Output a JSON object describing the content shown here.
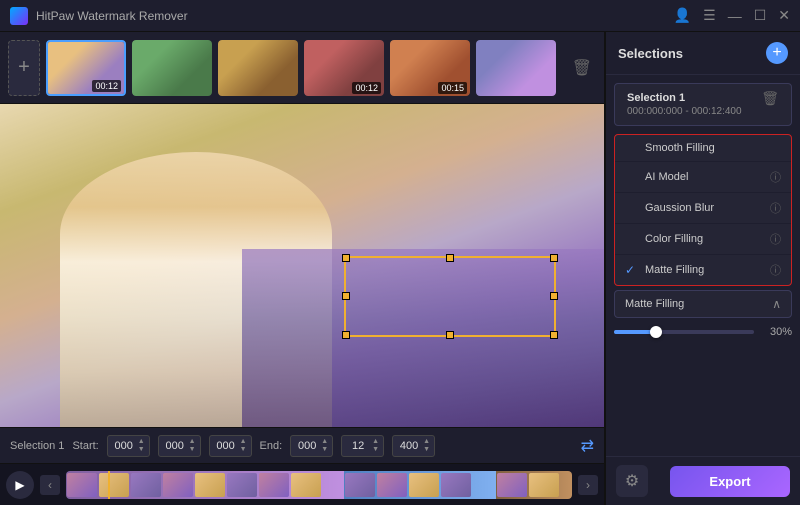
{
  "titlebar": {
    "title": "HitPaw Watermark Remover",
    "controls": [
      "user-icon",
      "menu-icon",
      "minimize-icon",
      "maximize-icon",
      "close-icon"
    ]
  },
  "toolbar": {
    "add_label": "+",
    "delete_label": "🗑"
  },
  "thumbnails": [
    {
      "id": 1,
      "duration": "00:12",
      "active": true
    },
    {
      "id": 2,
      "duration": "",
      "active": false
    },
    {
      "id": 3,
      "duration": "",
      "active": false
    },
    {
      "id": 4,
      "duration": "00:12",
      "active": false
    },
    {
      "id": 5,
      "duration": "00:15",
      "active": false
    },
    {
      "id": 6,
      "duration": "",
      "active": false
    }
  ],
  "control_bar": {
    "selection_label": "Selection 1",
    "start_label": "Start:",
    "end_label": "End:",
    "start_h": "000",
    "start_m": "000",
    "start_s": "000",
    "end_h": "000",
    "end_m": "12",
    "end_s": "400"
  },
  "right_panel": {
    "title": "Selections",
    "add_icon": "+",
    "selection1": {
      "name": "Selection 1",
      "time": "000:000:000 - 000:12:400"
    }
  },
  "methods": [
    {
      "label": "Smooth Filling",
      "info": "",
      "checked": false
    },
    {
      "label": "AI Model",
      "info": "ⓘ",
      "checked": false
    },
    {
      "label": "Gaussion Blur",
      "info": "ⓘ",
      "checked": false
    },
    {
      "label": "Color Filling",
      "info": "ⓘ",
      "checked": false
    },
    {
      "label": "Matte Filling",
      "info": "ⓘ",
      "checked": true
    }
  ],
  "active_method": {
    "label": "Matte Filling",
    "chevron": "∧"
  },
  "slider": {
    "value": "30%",
    "fill_pct": 30
  },
  "bottom_bar": {
    "export_label": "Export",
    "settings_icon": "⚙"
  }
}
